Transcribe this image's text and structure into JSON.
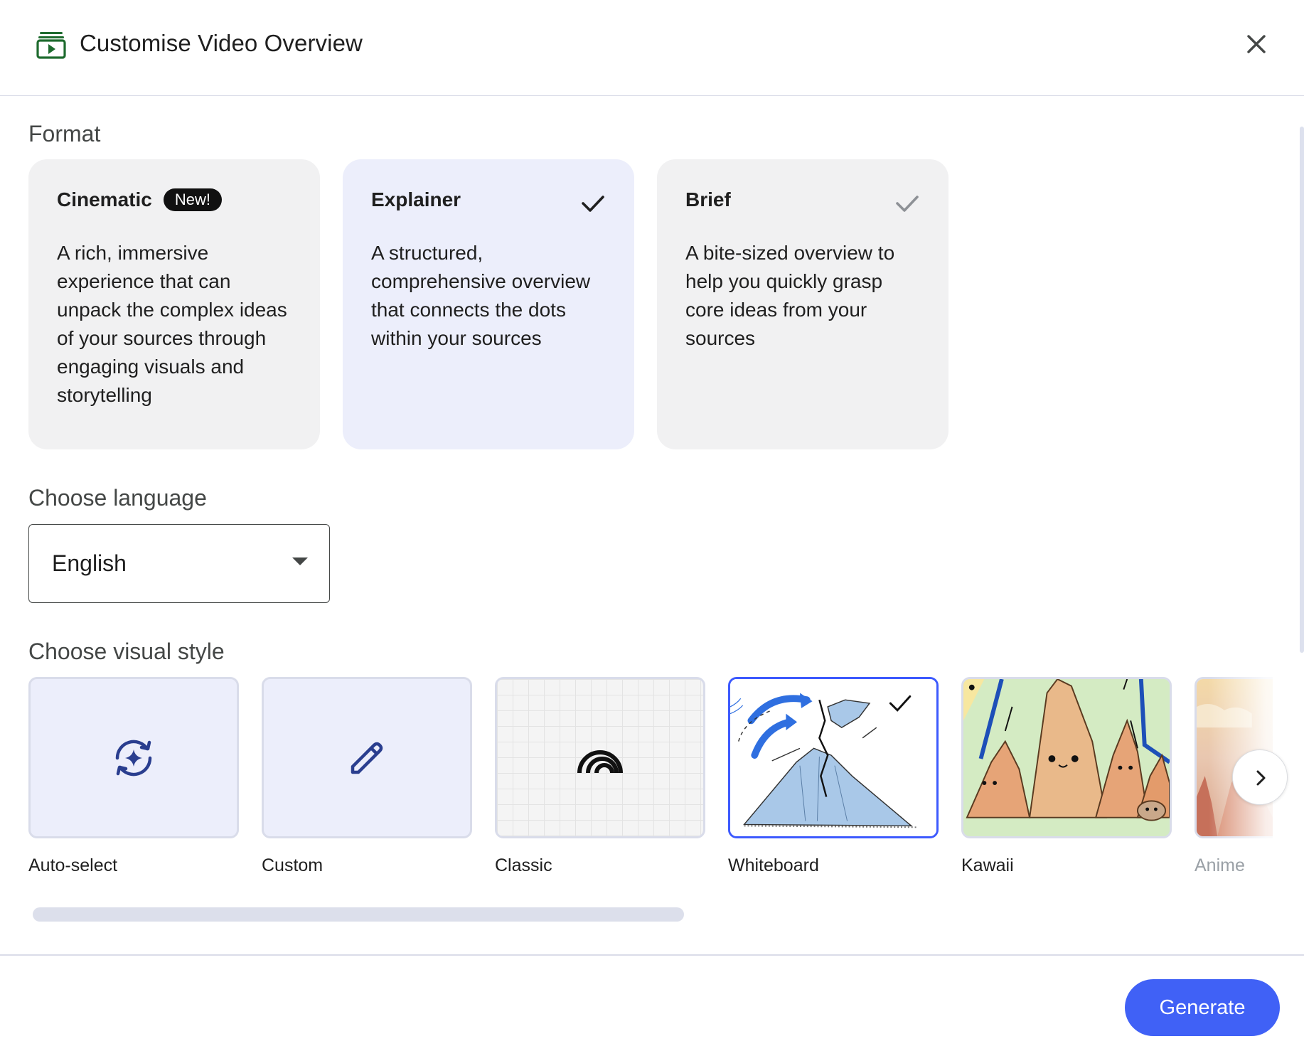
{
  "header": {
    "title": "Customise Video Overview",
    "icon": "video-overview-icon",
    "close_icon": "close-icon"
  },
  "format": {
    "label": "Format",
    "options": [
      {
        "title": "Cinematic",
        "badge": "New!",
        "description": "A rich, immersive experience that can unpack the complex ideas of your sources through engaging visuals and storytelling",
        "selected": false
      },
      {
        "title": "Explainer",
        "description": "A structured, comprehensive overview that connects the dots within your sources",
        "selected": true
      },
      {
        "title": "Brief",
        "description": "A bite-sized overview to help you quickly grasp core ideas from your sources",
        "selected": false
      }
    ]
  },
  "language": {
    "label": "Choose language",
    "selected": "English"
  },
  "visual_style": {
    "label": "Choose visual style",
    "options": [
      {
        "label": "Auto-select",
        "icon": "auto-select-sparkle-icon",
        "selected": false
      },
      {
        "label": "Custom",
        "icon": "pencil-icon",
        "selected": false
      },
      {
        "label": "Classic",
        "icon": "rainbow-arcs-icon",
        "selected": false
      },
      {
        "label": "Whiteboard",
        "icon": "whiteboard-preview",
        "selected": true
      },
      {
        "label": "Kawaii",
        "icon": "kawaii-preview",
        "selected": false
      },
      {
        "label": "Anime",
        "icon": "anime-preview",
        "selected": false
      }
    ]
  },
  "footer": {
    "generate_label": "Generate"
  },
  "colors": {
    "accent": "#4061f6",
    "selected_card_bg": "#eceefb",
    "card_bg": "#f1f1f2",
    "header_icon": "#1e6b2e"
  }
}
